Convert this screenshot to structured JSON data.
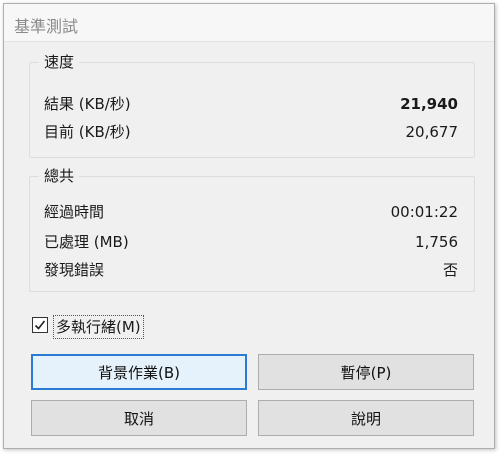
{
  "window": {
    "title": "基準測試"
  },
  "speed": {
    "legend": "速度",
    "result_label": "結果 (KB/秒)",
    "result_value": "21,940",
    "current_label": "目前 (KB/秒)",
    "current_value": "20,677"
  },
  "total": {
    "legend": "總共",
    "elapsed_label": "經過時間",
    "elapsed_value": "00:01:22",
    "processed_label": "已處理 (MB)",
    "processed_value": "1,756",
    "errors_label": "發現錯誤",
    "errors_value": "否"
  },
  "multithread": {
    "label": "多執行緒(M)",
    "checked": true
  },
  "buttons": {
    "background": "背景作業(B)",
    "pause": "暫停(P)",
    "cancel": "取消",
    "help": "說明"
  },
  "colors": {
    "accent": "#2a7bd4",
    "button_face": "#e1e1e1",
    "dialog_bg": "#f0f0f0"
  }
}
